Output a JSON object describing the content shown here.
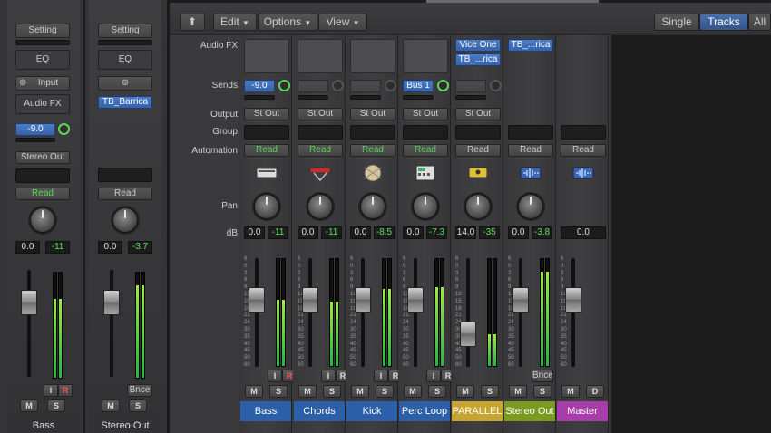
{
  "toolbar": {
    "edit": "Edit",
    "options": "Options",
    "view": "View",
    "single": "Single",
    "tracks": "Tracks",
    "all": "All"
  },
  "row_labels": {
    "audio_fx": "Audio FX",
    "sends": "Sends",
    "output": "Output",
    "group": "Group",
    "automation": "Automation",
    "pan": "Pan",
    "db": "dB"
  },
  "inspector": [
    {
      "name": "Bass",
      "setting": "Setting",
      "eq": "EQ",
      "input": "Input",
      "audio_fx": "Audio FX",
      "send": "-9.0",
      "output": "Stereo Out",
      "automation": "Read",
      "vol": "0.0",
      "peak": "-11",
      "i": "I",
      "r": "R",
      "m": "M",
      "s": "S"
    },
    {
      "name": "Stereo Out",
      "setting": "Setting",
      "eq": "EQ",
      "fx": "TB_Barrica",
      "automation": "Read",
      "vol": "0.0",
      "peak": "-3.7",
      "bnce": "Bnce",
      "m": "M",
      "s": "S"
    }
  ],
  "channels": [
    {
      "name": "Bass",
      "send": "-9.0",
      "output": "St Out",
      "automation": "Read",
      "vol": "0.0",
      "peak": "-11",
      "i": "I",
      "r": "R",
      "m": "M",
      "s": "S",
      "color": "#2b5fa8",
      "level": 0.62,
      "fader": 0.73
    },
    {
      "name": "Chords",
      "send": "",
      "output": "St Out",
      "automation": "Read",
      "vol": "0.0",
      "peak": "-11",
      "i": "I",
      "r": "R",
      "m": "M",
      "s": "S",
      "color": "#2b5fa8",
      "level": 0.6,
      "fader": 0.73
    },
    {
      "name": "Kick",
      "send": "",
      "output": "St Out",
      "automation": "Read",
      "vol": "0.0",
      "peak": "-8.5",
      "i": "I",
      "r": "R",
      "m": "M",
      "s": "S",
      "color": "#2b5fa8",
      "level": 0.72,
      "fader": 0.73
    },
    {
      "name": "Perc Loop",
      "send": "Bus 1",
      "output": "St Out",
      "automation": "Read",
      "vol": "0.0",
      "peak": "-7.3",
      "i": "I",
      "r": "R",
      "m": "M",
      "s": "S",
      "color": "#2b5fa8",
      "level": 0.74,
      "fader": 0.73
    },
    {
      "name": "PARALLEL",
      "fx": [
        "Vice One",
        "TB_...rica"
      ],
      "output": "St Out",
      "automation": "Read",
      "vol": "14.0",
      "peak": "-35",
      "m": "M",
      "s": "S",
      "color": "#c8a530",
      "level": 0.3,
      "fader": 0.42
    },
    {
      "name": "Stereo Out",
      "fx": [
        "TB_...rica"
      ],
      "automation": "Read",
      "vol": "0.0",
      "peak": "-3.8",
      "bnce": "Bnce",
      "m": "M",
      "s": "S",
      "color": "#7a9a20",
      "level": 0.88,
      "fader": 0.73
    },
    {
      "name": "Master",
      "automation": "Read",
      "vol": "0.0",
      "m": "M",
      "d": "D",
      "color": "#a83ca8",
      "fader": 0.73
    }
  ],
  "scale": [
    "6",
    "0",
    "3",
    "6",
    "9",
    "12",
    "15",
    "18",
    "21",
    "24",
    "30",
    "35",
    "40",
    "45",
    "50",
    "60"
  ],
  "icons": [
    "keyboard-icon",
    "synth-icon",
    "drum-icon",
    "drum-machine-icon",
    "bus-icon",
    "waveform-icon",
    "waveform-icon"
  ]
}
